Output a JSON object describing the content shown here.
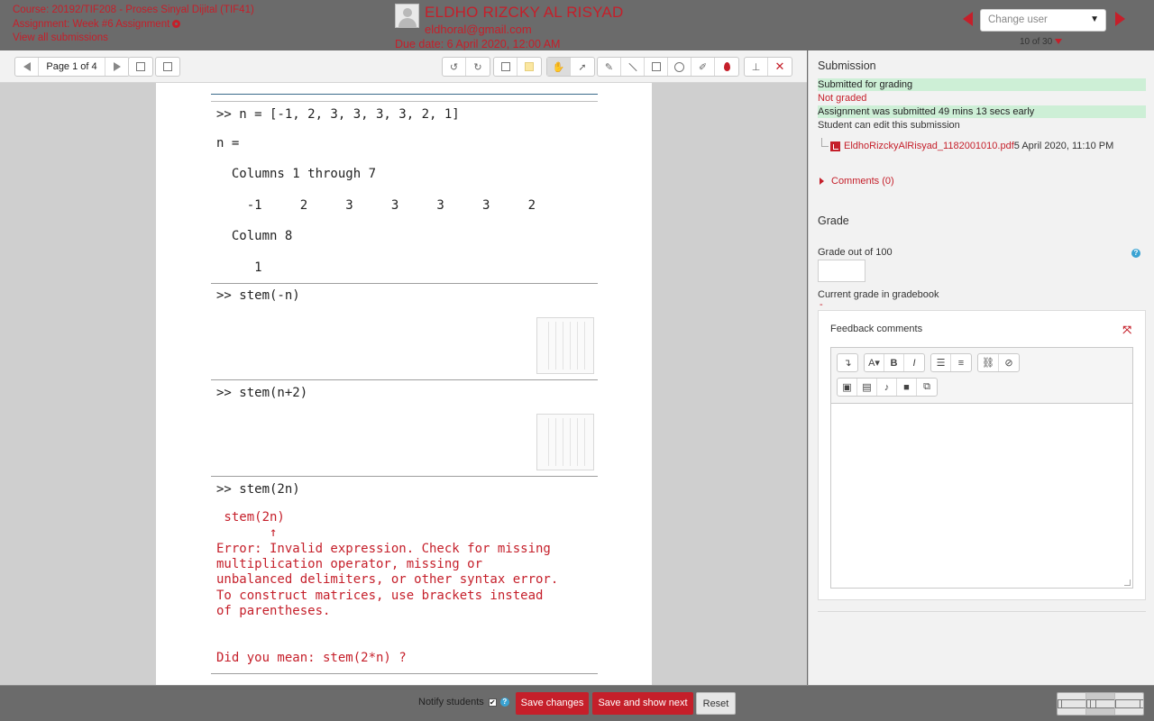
{
  "header": {
    "course": "Course: 20192/TIF208 - Proses Sinyal Dijital (TIF41)",
    "assignment": "Assignment: Week #6 Assignment",
    "view_all": "View all submissions",
    "user_name": "ELDHO RIZCKY AL RISYAD",
    "user_email": "eldhoral@gmail.com",
    "due_date": "Due date: 6 April 2020, 12:00 AM",
    "change_user_placeholder": "Change user",
    "user_count": "10 of 30"
  },
  "toolbar": {
    "page_label": "Page 1 of 4"
  },
  "document": {
    "lines": [
      ">> n = [-1, 2, 3, 3, 3, 3, 2, 1]",
      "n =",
      "  Columns 1 through 7",
      "    -1     2     3     3     3     3     2",
      "  Column 8",
      "     1",
      ">> stem(-n)",
      ">> stem(n+2)",
      ">> stem(2n)",
      " stem(2n)",
      "       ↑",
      "Error: Invalid expression. Check for missing",
      "multiplication operator, missing or",
      "unbalanced delimiters, or other syntax error.",
      "To construct matrices, use brackets instead",
      "of parentheses.",
      "Did you mean: stem(2*n) ?"
    ]
  },
  "submission": {
    "title": "Submission",
    "status_submitted": "Submitted for grading",
    "status_grading": "Not graded",
    "status_time": "Assignment was submitted 49 mins 13 secs early",
    "status_edit": "Student can edit this submission",
    "file_name": "EldhoRizckyAlRisyad_1182001010.pdf",
    "file_date": "5 April 2020, 11:10 PM",
    "comments": "Comments (0)"
  },
  "grade": {
    "title": "Grade",
    "grade_label": "Grade out of 100",
    "grade_value": "",
    "current_grade_label": "Current grade in gradebook",
    "current_grade_value": "-",
    "feedback_label": "Feedback comments"
  },
  "footer": {
    "notify_label": "Notify students",
    "save_changes": "Save changes",
    "save_next": "Save and show next",
    "reset": "Reset"
  },
  "colors": {
    "accent": "#c51f2a",
    "green_highlight": "#cdefd6",
    "chrome": "#6b6b6b"
  }
}
